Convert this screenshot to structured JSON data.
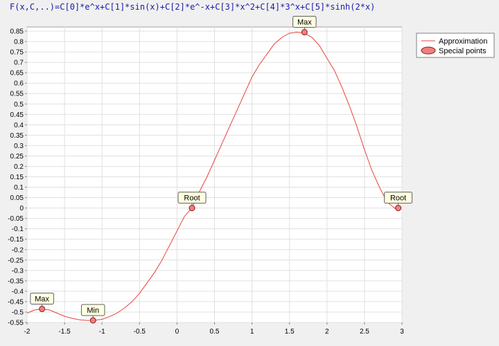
{
  "formula": "F(x,C,..)=C[0]*e^x+C[1]*sin(x)+C[2]*e^-x+C[3]*x^2+C[4]*3^x+C[5]*sinh(2*x)",
  "colors": {
    "curve": "#e8413c",
    "point_fill": "#f08080",
    "annotation_bg": "#ffffe1",
    "grid": "#e0e0e0"
  },
  "chart_data": {
    "type": "line",
    "x_ticks": [
      "-2",
      "-1.5",
      "-1",
      "-0.5",
      "0",
      "0.5",
      "1",
      "1.5",
      "2",
      "2.5",
      "3"
    ],
    "y_ticks": [
      "0.85",
      "0.8",
      "0.75",
      "0.7",
      "0.65",
      "0.6",
      "0.55",
      "0.5",
      "0.45",
      "0.4",
      "0.35",
      "0.3",
      "0.25",
      "0.2",
      "0.15",
      "0.1",
      "0.05",
      "0",
      "-0.05",
      "-0.1",
      "-0.15",
      "-0.2",
      "-0.25",
      "-0.3",
      "-0.35",
      "-0.4",
      "-0.45",
      "-0.5",
      "-0.55"
    ],
    "xlim": [
      -2,
      3
    ],
    "ylim": [
      -0.55,
      0.87
    ],
    "grid": true,
    "legend_position": "right",
    "series": [
      {
        "name": "Approximation",
        "x": [
          -2.0,
          -1.9,
          -1.8,
          -1.7,
          -1.6,
          -1.5,
          -1.4,
          -1.3,
          -1.2,
          -1.12,
          -1.0,
          -0.9,
          -0.8,
          -0.7,
          -0.6,
          -0.5,
          -0.4,
          -0.3,
          -0.2,
          -0.1,
          0.0,
          0.1,
          0.2,
          0.3,
          0.4,
          0.5,
          0.6,
          0.7,
          0.8,
          0.9,
          1.0,
          1.1,
          1.2,
          1.3,
          1.4,
          1.5,
          1.6,
          1.7,
          1.8,
          1.9,
          2.0,
          2.1,
          2.2,
          2.3,
          2.4,
          2.5,
          2.6,
          2.7,
          2.8,
          2.9,
          2.95
        ],
        "values": [
          -0.505,
          -0.49,
          -0.485,
          -0.49,
          -0.505,
          -0.52,
          -0.53,
          -0.537,
          -0.54,
          -0.54,
          -0.535,
          -0.522,
          -0.505,
          -0.48,
          -0.45,
          -0.41,
          -0.36,
          -0.31,
          -0.25,
          -0.18,
          -0.11,
          -0.04,
          0.0,
          0.08,
          0.15,
          0.23,
          0.31,
          0.39,
          0.47,
          0.55,
          0.63,
          0.69,
          0.74,
          0.79,
          0.82,
          0.84,
          0.845,
          0.84,
          0.82,
          0.78,
          0.72,
          0.66,
          0.58,
          0.49,
          0.39,
          0.28,
          0.18,
          0.1,
          0.03,
          0.0,
          -0.01
        ]
      },
      {
        "name": "Special points",
        "points": [
          {
            "x": -1.8,
            "y": -0.485,
            "label": "Max"
          },
          {
            "x": -1.12,
            "y": -0.54,
            "label": "Min"
          },
          {
            "x": 0.2,
            "y": 0.0,
            "label": "Root"
          },
          {
            "x": 1.7,
            "y": 0.845,
            "label": "Max"
          },
          {
            "x": 2.95,
            "y": 0.0,
            "label": "Root"
          }
        ]
      }
    ]
  }
}
